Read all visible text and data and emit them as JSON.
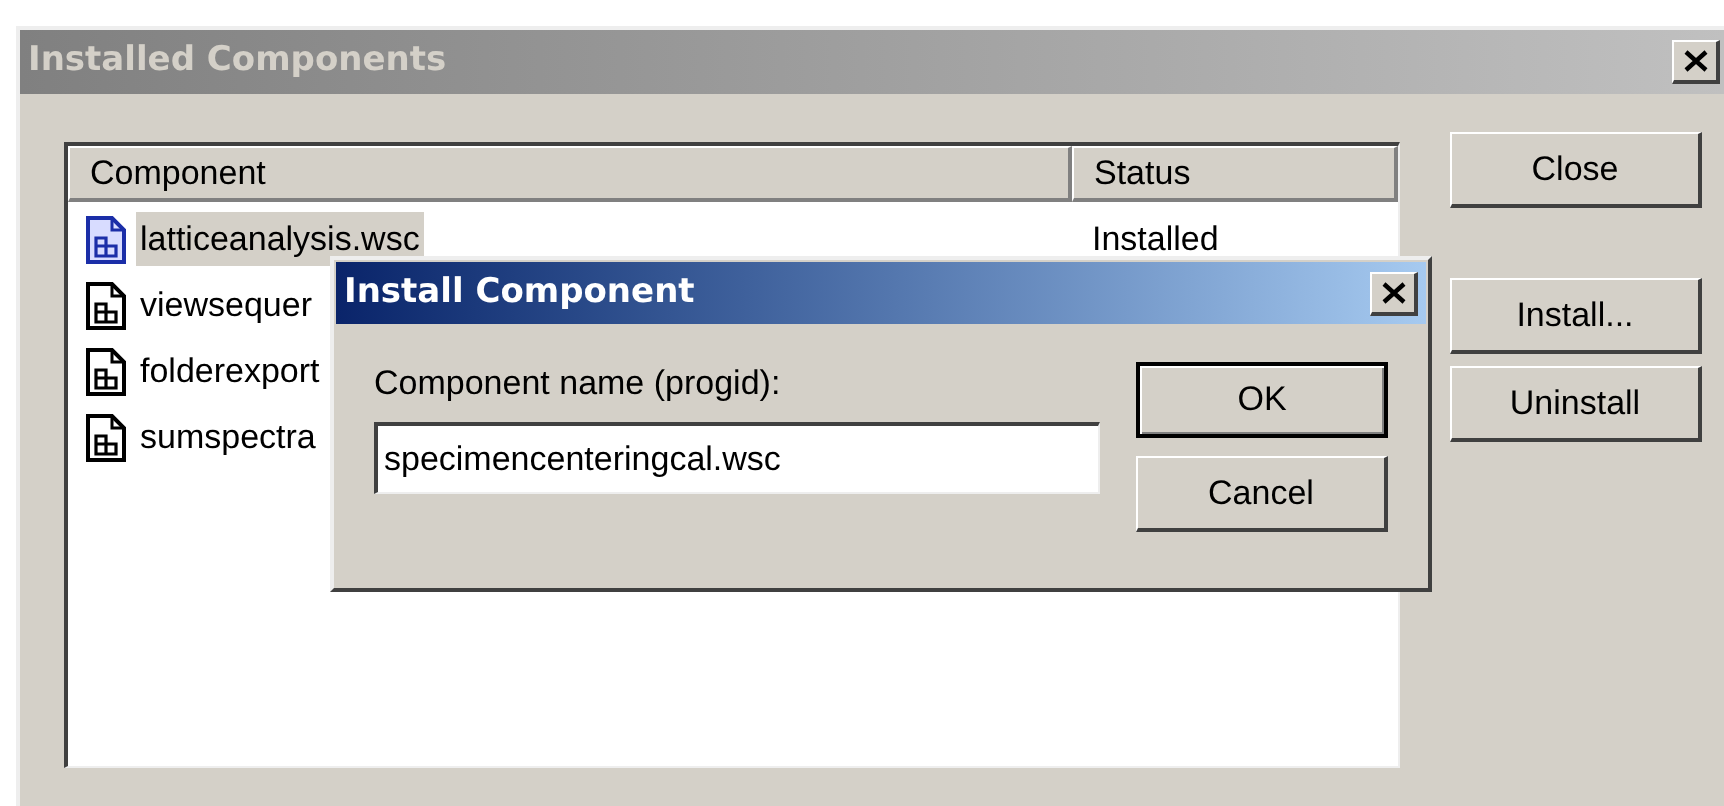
{
  "window": {
    "title": "Installed Components",
    "active": false
  },
  "list": {
    "columns": [
      "Component",
      "Status"
    ],
    "rows": [
      {
        "component": "latticeanalysis.wsc",
        "status": "Installed",
        "selected": true
      },
      {
        "component": "viewsequer",
        "selected": false
      },
      {
        "component": "folderexport",
        "selected": false
      },
      {
        "component": "sumspectra",
        "selected": false
      }
    ]
  },
  "buttons": [
    "Close",
    "Install...",
    "Uninstall"
  ],
  "dialog": {
    "title": "Install Component",
    "active": true,
    "label": "Component name (progid):",
    "value": "specimencenteringcal.wsc",
    "buttons": [
      {
        "label": "OK",
        "default": true
      },
      {
        "label": "Cancel",
        "default": false
      }
    ]
  }
}
